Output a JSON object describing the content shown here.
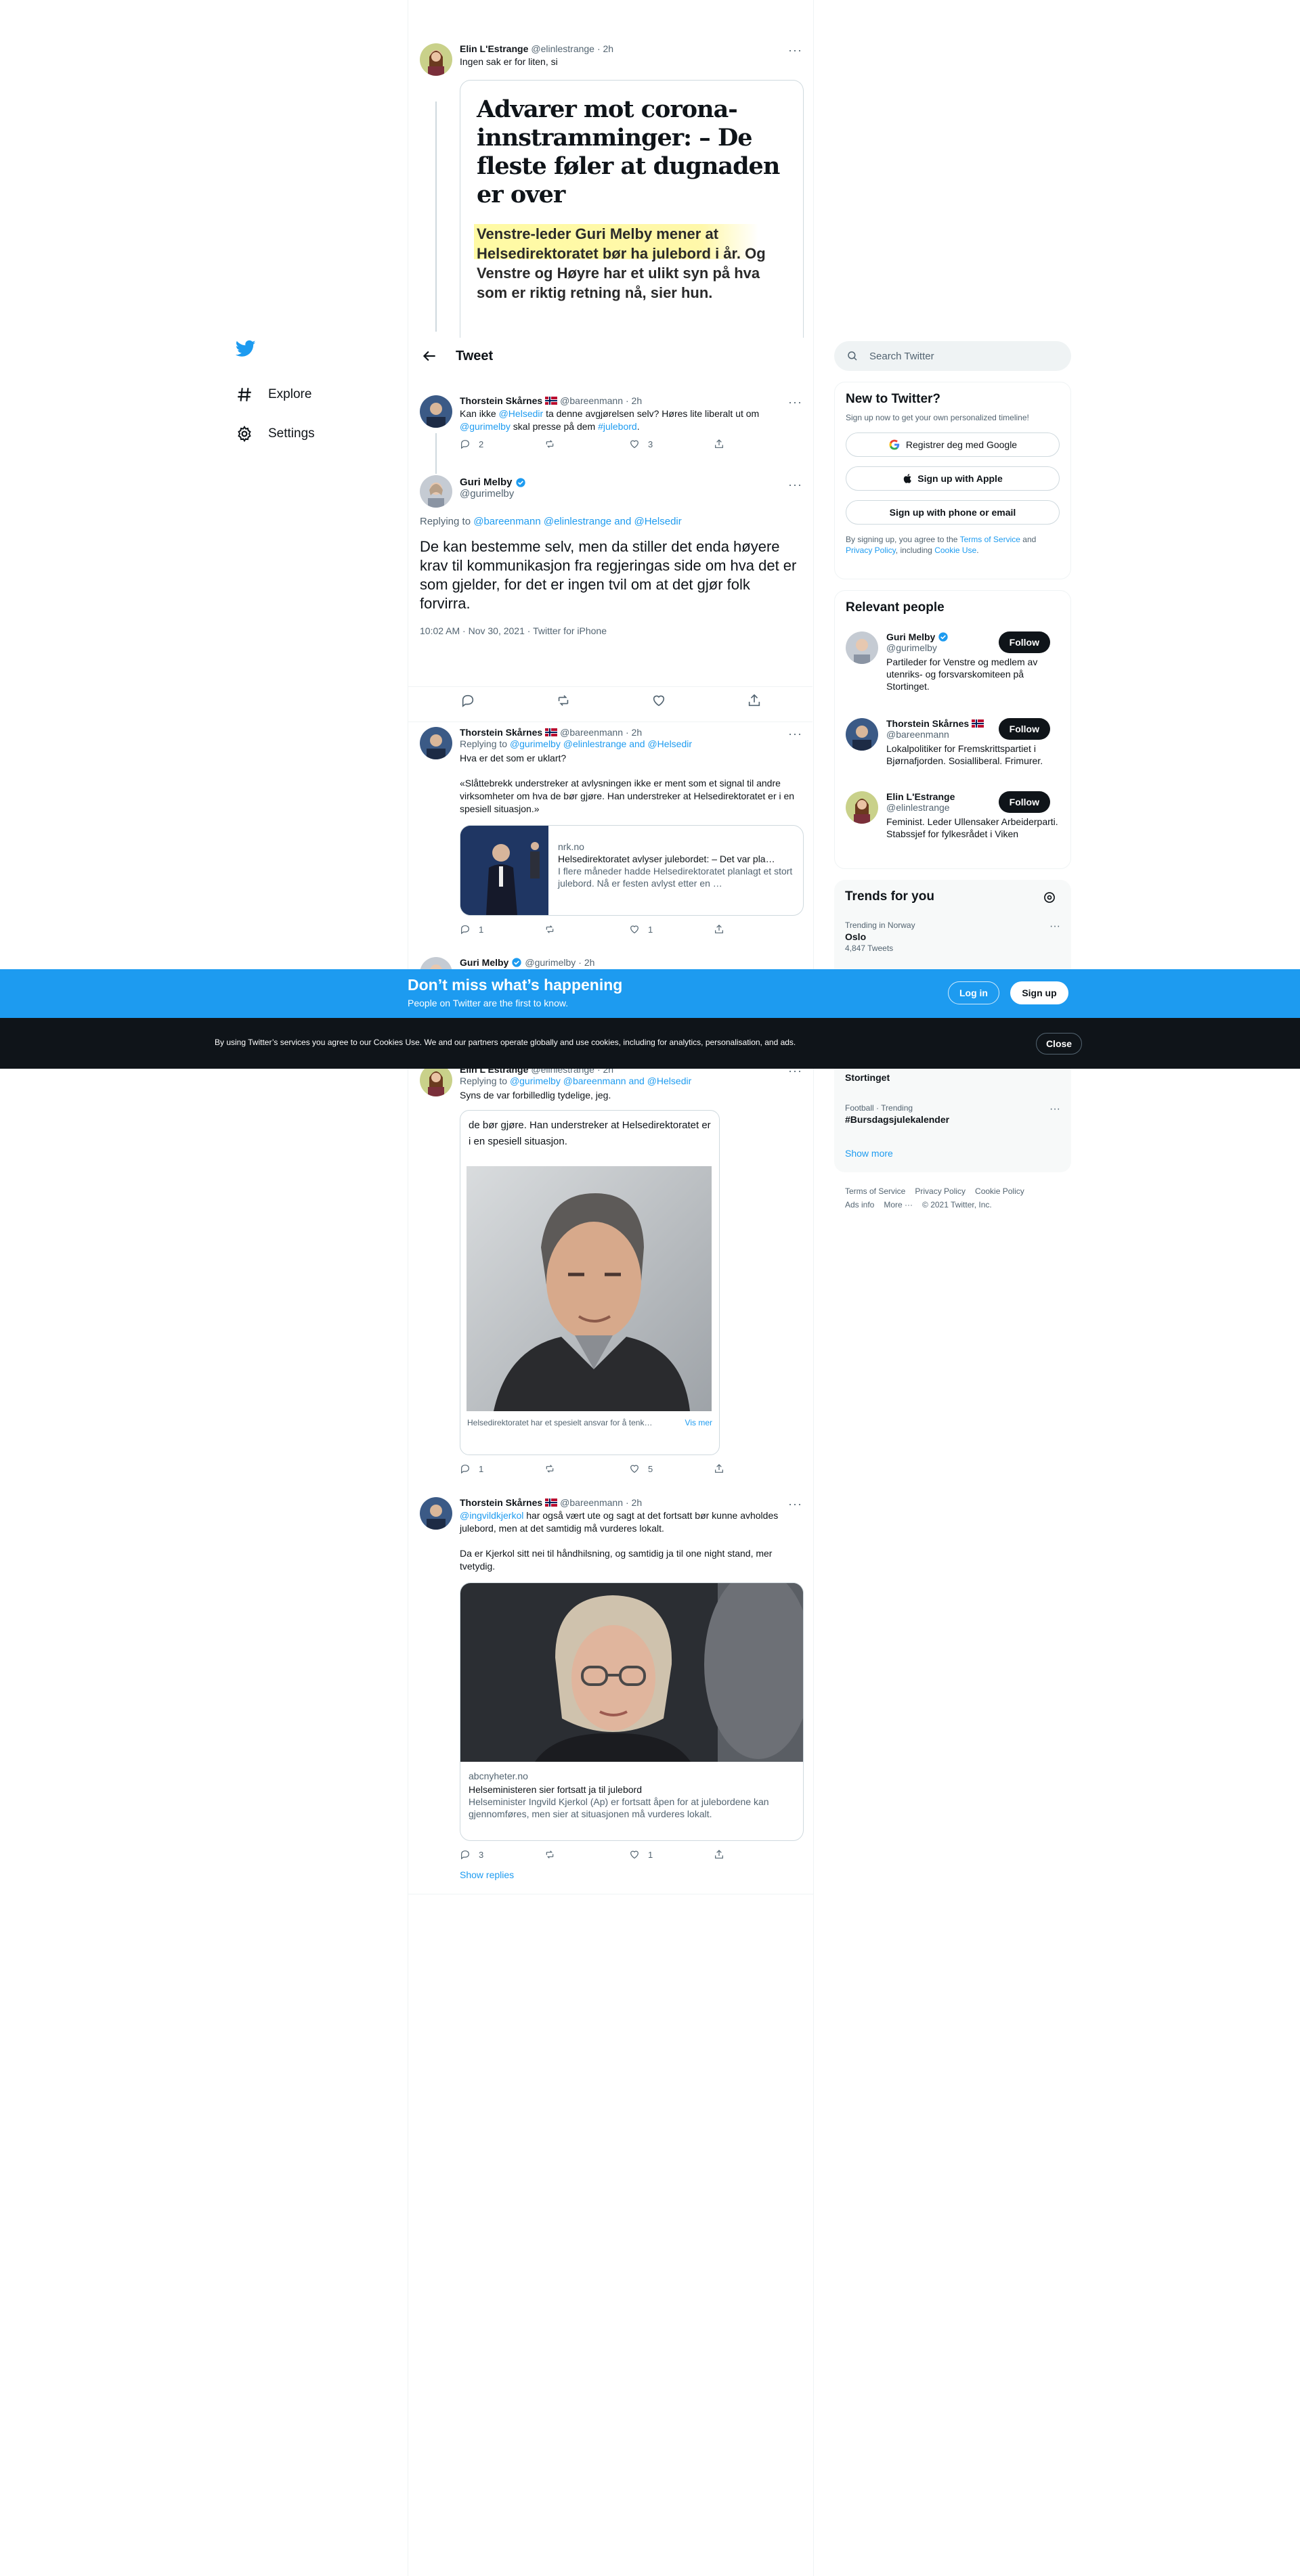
{
  "nav": {
    "items": [
      {
        "label": "Explore"
      },
      {
        "label": "Settings"
      }
    ]
  },
  "header": {
    "title": "Tweet"
  },
  "search": {
    "placeholder": "Search Twitter"
  },
  "tweets": {
    "t1": {
      "name": "Elin L'Estrange",
      "handle": "@elinlestrange",
      "time": "· 2h",
      "text": "Ingen sak er for liten, si"
    },
    "article": {
      "headline": "Advarer mot corona-innstramminger: – De fleste føler at dugnaden er over",
      "lead": "Venstre-leder Guri Melby mener at Helsedirektoratet bør ha julebord i år. Og Venstre og Høyre har et ulikt syn på hva som er riktig retning nå, sier hun."
    },
    "t2": {
      "name": "Thorstein Skårnes",
      "handle": "@bareenmann",
      "time": "· 2h",
      "p1": "Kan ikke",
      "m1": "@Helsedir",
      "p2": "ta denne avgjørelsen selv? Høres lite liberalt ut om",
      "m2": "@gurimelby",
      "p3": "skal presse på dem",
      "m3": "#julebord",
      "p4": ".",
      "replies": "2",
      "likes": "3"
    },
    "main": {
      "name": "Guri Melby",
      "handle": "@gurimelby",
      "replying_prefix": "Replying to",
      "replying_to": "@bareenmann @elinlestrange and @Helsedir",
      "text": "De kan bestemme selv, men da stiller det enda høyere krav til kommunikasjon fra regjeringas side om hva det er som gjelder, for det er ingen tvil om at det gjør folk forvirra.",
      "timestamp": "10:02 AM · Nov 30, 2021 · Twitter for iPhone"
    },
    "t3": {
      "name": "Thorstein Skårnes",
      "handle": "@bareenmann",
      "time": "· 2h",
      "replying_prefix": "Replying to",
      "replying_to": "@gurimelby @elinlestrange and @Helsedir",
      "text1": "Hva er det som er uklart?",
      "text2": "«Slåttebrekk understreker at avlysningen ikke er ment som et signal til andre virksomheter om hva de bør gjøre. Han understreker at Helsedirektoratet er i en spesiell situasjon.»",
      "card_domain": "nrk.no",
      "card_title": "Helsedirektoratet avlyser julebordet: – Det var pla…",
      "card_desc": "I flere måneder hadde Helsedirektoratet planlagt et stort julebord. Nå er festen avlyst etter en …",
      "replies": "1",
      "likes": "1"
    },
    "t4": {
      "name": "Guri Melby",
      "handle": "@gurimelby",
      "time": "· 2h"
    },
    "t5": {
      "name": "Elin L'Estrange",
      "handle": "@elinlestrange",
      "time": "· 2h",
      "replying_prefix": "Replying to",
      "replying_to": "@gurimelby @bareenmann and @Helsedir",
      "text": "Syns de var forbilledlig tydelige, jeg.",
      "quote_text": "de bør gjøre. Han understreker at Helsedirektoratet er i en spesiell situasjon.",
      "caption": "Helsedirektoratet har et spesielt ansvar for å tenk…",
      "vis_mer": "Vis mer",
      "replies": "1",
      "likes": "5"
    },
    "t6": {
      "name": "Thorstein Skårnes",
      "handle": "@bareenmann",
      "time": "· 2h",
      "m1": "@ingvildkjerkol",
      "p1": "har også vært ute og sagt at det fortsatt bør kunne avholdes julebord, men at det samtidig må vurderes lokalt.",
      "text2": "Da er Kjerkol sitt nei til håndhilsning, og samtidig ja til one night stand, mer tvetydig.",
      "card_domain": "abcnyheter.no",
      "card_title": "Helseministeren sier fortsatt ja til julebord",
      "card_desc": "Helseminister Ingvild Kjerkol (Ap) er fortsatt åpen for at julebordene kan gjennomføres, men sier at situasjonen må vurderes lokalt.",
      "replies": "3",
      "likes": "1",
      "show_replies": "Show replies"
    }
  },
  "new_to_twitter": {
    "title": "New to Twitter?",
    "subtitle": "Sign up now to get your own personalized timeline!",
    "google": "Registrer deg med Google",
    "apple": "Sign up with Apple",
    "phone": "Sign up with phone or email",
    "legal_1": "By signing up, you agree to the",
    "tos": "Terms of Service",
    "legal_2": "and",
    "privacy": "Privacy Policy",
    "legal_3": ", including",
    "cookie": "Cookie Use",
    "legal_4": "."
  },
  "relevant": {
    "title": "Relevant people",
    "follow": "Follow",
    "people": [
      {
        "name": "Guri Melby",
        "handle": "@gurimelby",
        "bio": "Partileder for Venstre og medlem av utenriks- og forsvarskomiteen på Stortinget."
      },
      {
        "name": "Thorstein Skårnes",
        "handle": "@bareenmann",
        "bio": "Lokalpolitiker for Fremskrittspartiet i Bjørnafjorden. Sosialliberal. Frimurer."
      },
      {
        "name": "Elin L'Estrange",
        "handle": "@elinlestrange",
        "bio": "Feminist. Leder Ullensaker Arbeiderparti. Stabssjef for fylkesrådet i Viken"
      }
    ]
  },
  "trends": {
    "title": "Trends for you",
    "items": [
      {
        "context": "Trending in Norway",
        "name": "Oslo",
        "count": "4,847 Tweets"
      },
      {
        "context": "",
        "name": "Stortinget",
        "count": ""
      },
      {
        "context": "Football · Trending",
        "name": "#Bursdagsjulekalender",
        "count": ""
      }
    ],
    "show_more": "Show more"
  },
  "footer": {
    "links": [
      "Terms of Service",
      "Privacy Policy",
      "Cookie Policy",
      "Ads info",
      "More ···"
    ],
    "copyright": "© 2021 Twitter, Inc."
  },
  "banner": {
    "title": "Don’t miss what’s happening",
    "subtitle": "People on Twitter are the first to know.",
    "login": "Log in",
    "signup": "Sign up"
  },
  "cookie_banner": {
    "text": "By using Twitter’s services you agree to our Cookies Use. We and our partners operate globally and use cookies, including for analytics, personalisation, and ads.",
    "close": "Close"
  },
  "colors": {
    "accent": "#1d9bf0",
    "dark": "#0f1419",
    "muted": "#536471",
    "border": "#cfd9de"
  }
}
